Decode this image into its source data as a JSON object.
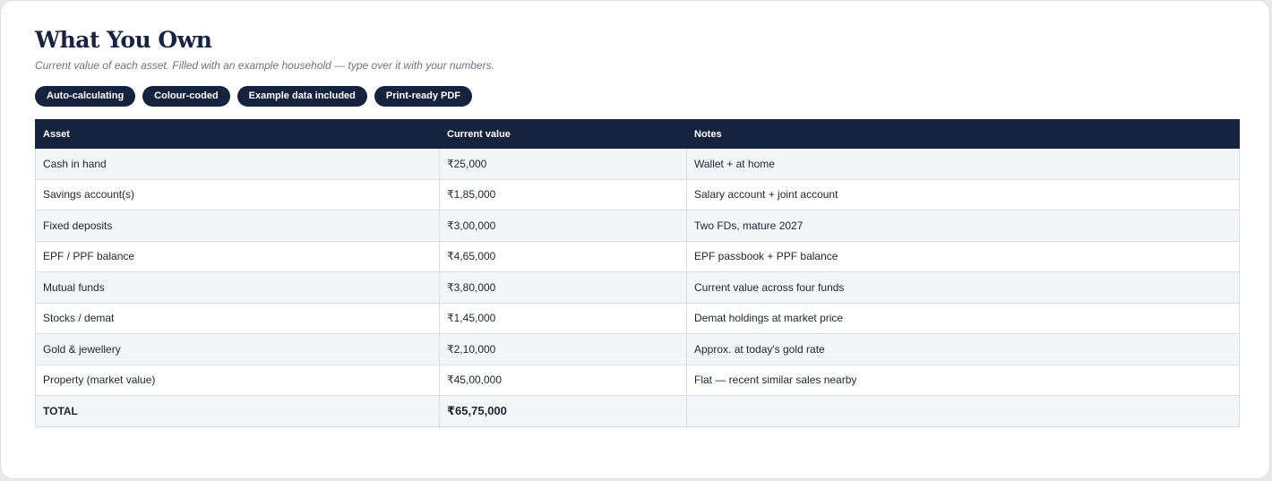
{
  "header": {
    "title": "What You Own",
    "subtitle": "Current value of each asset. Filled with an example household — type over it with your numbers."
  },
  "badges": [
    "Auto-calculating",
    "Colour-coded",
    "Example data included",
    "Print-ready PDF"
  ],
  "table": {
    "columns": [
      "Asset",
      "Current value",
      "Notes"
    ],
    "rows": [
      {
        "asset": "Cash in hand",
        "value": "₹25,000",
        "notes": "Wallet + at home"
      },
      {
        "asset": "Savings account(s)",
        "value": "₹1,85,000",
        "notes": "Salary account + joint account"
      },
      {
        "asset": "Fixed deposits",
        "value": "₹3,00,000",
        "notes": "Two FDs, mature 2027"
      },
      {
        "asset": "EPF / PPF balance",
        "value": "₹4,65,000",
        "notes": "EPF passbook + PPF balance"
      },
      {
        "asset": "Mutual funds",
        "value": "₹3,80,000",
        "notes": "Current value across four funds"
      },
      {
        "asset": "Stocks / demat",
        "value": "₹1,45,000",
        "notes": "Demat holdings at market price"
      },
      {
        "asset": "Gold & jewellery",
        "value": "₹2,10,000",
        "notes": "Approx. at today's gold rate"
      },
      {
        "asset": "Property (market value)",
        "value": "₹45,00,000",
        "notes": "Flat — recent similar sales nearby"
      }
    ],
    "total": {
      "label": "TOTAL",
      "value": "₹65,75,000",
      "notes": ""
    }
  },
  "colors": {
    "brand_navy": "#16233f",
    "row_alt": "#f4f5f9",
    "border": "#d9dce3"
  }
}
